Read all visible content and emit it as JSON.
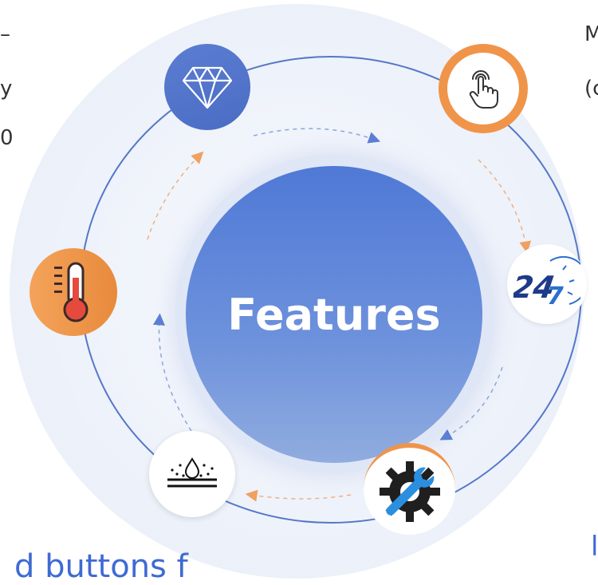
{
  "center": {
    "label": "Features"
  },
  "fragments": {
    "left_line1": "–",
    "left_line2": "y",
    "left_line3": "0",
    "right_line1": "M",
    "right_line2": "(c",
    "bottom_right": "l",
    "bottom_left": "d buttons f"
  },
  "nodes": [
    {
      "icon": "diamond-icon",
      "color": "#4f72c9"
    },
    {
      "icon": "touch-finger-icon",
      "color": "#f0944a"
    },
    {
      "icon": "24-7-service-icon",
      "color": "#2563c9"
    },
    {
      "icon": "wrench-gear-icon",
      "color": "#1f1f1f"
    },
    {
      "icon": "waterproof-icon",
      "color": "#111111"
    },
    {
      "icon": "thermometer-icon",
      "color": "#e04a3a"
    }
  ],
  "colors": {
    "accent": "#4f79d6",
    "orange": "#f0944a"
  }
}
